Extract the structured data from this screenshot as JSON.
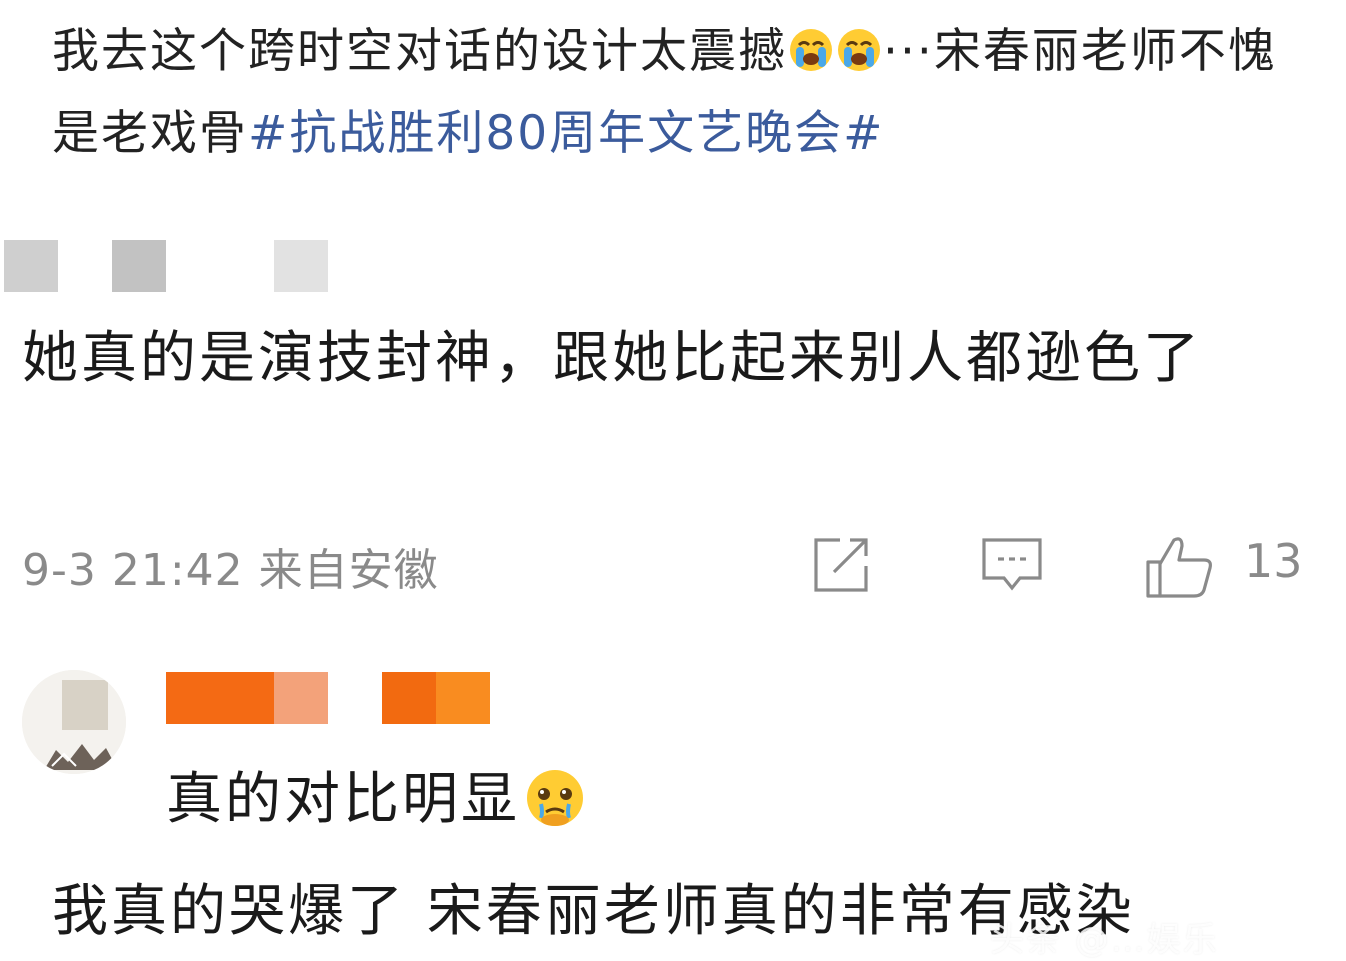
{
  "post": {
    "text_before_emoji": "我去这个跨时空对话的设计太震撼",
    "text_after_emoji": "···宋春丽老师不愧是老戏骨",
    "hashtag": "#抗战胜利80周年文艺晚会#",
    "emoji_icons": [
      "crying-face-icon",
      "crying-face-icon"
    ]
  },
  "comment": {
    "text": "她真的是演技封神，跟她比起来别人都逊色了",
    "timestamp": "9-3 21:42",
    "source": "来自安徽",
    "like_count": "13",
    "action_icons": [
      "share-icon",
      "comment-icon",
      "like-icon"
    ]
  },
  "reply": {
    "text": "真的对比明显",
    "emoji_icon": "pleading-face-icon"
  },
  "bottom": {
    "text": "我真的哭爆了 宋春丽老师真的非常有感染"
  },
  "watermark": {
    "text": "头条 @…娱乐"
  },
  "colors": {
    "text": "#1a1a1a",
    "hashtag": "#3b5b9c",
    "meta": "#8a8a8a",
    "mask_gray": "#c8c8c8",
    "mask_orange": "#f46a14"
  }
}
